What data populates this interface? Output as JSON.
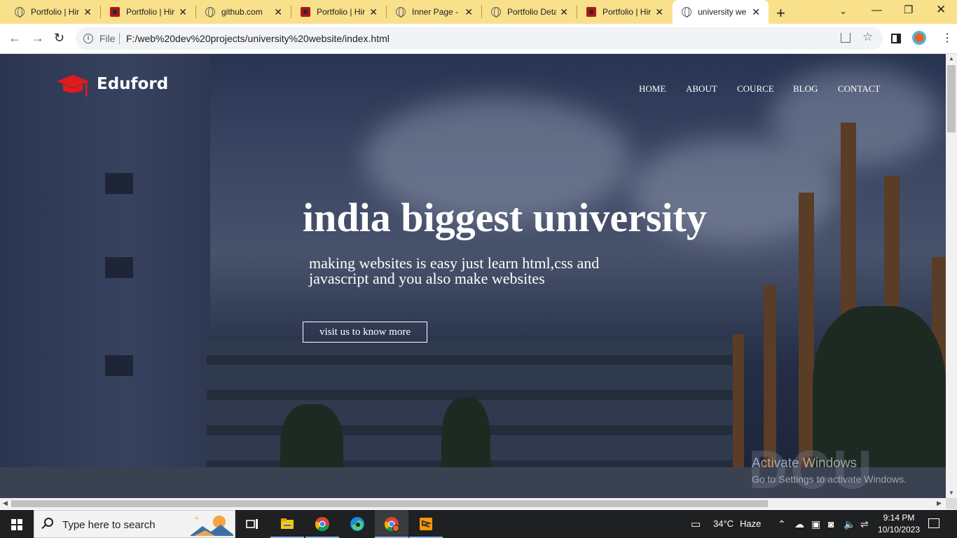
{
  "browser": {
    "tabs": [
      {
        "title": "Portfolio | Hir",
        "favicon": "globe-icon",
        "active": false
      },
      {
        "title": "Portfolio | Hir",
        "favicon": "portfolio-icon",
        "active": false
      },
      {
        "title": "github.com",
        "favicon": "globe-icon",
        "active": false
      },
      {
        "title": "Portfolio | Hir",
        "favicon": "portfolio-icon",
        "active": false
      },
      {
        "title": "Inner Page - ",
        "favicon": "globe-icon",
        "active": false
      },
      {
        "title": "Portfolio Deta",
        "favicon": "globe-icon",
        "active": false
      },
      {
        "title": "Portfolio | Hir",
        "favicon": "portfolio-icon",
        "active": false
      },
      {
        "title": "university wel",
        "favicon": "globe-icon",
        "active": true
      }
    ],
    "address_bar": {
      "scheme": "File",
      "url": "F:/web%20dev%20projects/university%20website/index.html"
    }
  },
  "site": {
    "logo_text": "Eduford",
    "nav": [
      "HOME",
      "ABOUT",
      "COURCE",
      "BLOG",
      "CONTACT"
    ],
    "hero": {
      "title": "india biggest university",
      "subtitle": "making websites is easy just learn html,css and javascript and you also make websites",
      "button": "visit us to know more"
    }
  },
  "watermark": {
    "line1": "Activate Windows",
    "line2": "Go to Settings to activate Windows."
  },
  "taskbar": {
    "search_placeholder": "Type here to search",
    "weather": {
      "temp": "34°C",
      "condition": "Haze"
    },
    "time": "9:14 PM",
    "date": "10/10/2023",
    "apps": [
      "task-view",
      "file-explorer",
      "chrome",
      "edge",
      "chrome-profile",
      "sublime-text"
    ]
  },
  "colors": {
    "tab_strip": "#f9e08b",
    "logo_accent": "#e01b1b",
    "hero_text": "#ffffff"
  }
}
